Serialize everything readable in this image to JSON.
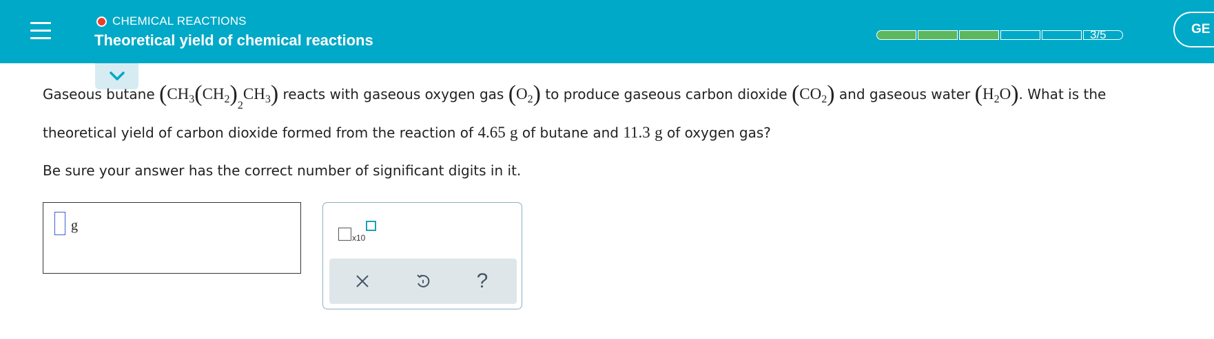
{
  "header": {
    "topic": "CHEMICAL REACTIONS",
    "title": "Theoretical yield of chemical reactions",
    "progress": {
      "completed": 3,
      "total": 5,
      "label": "3/5"
    },
    "go_button_label": "GE",
    "colors": {
      "header_bg": "#00a9c7",
      "progress_fill": "#5cb85c",
      "topic_dot": "#e8412c"
    }
  },
  "question": {
    "p1_a": "Gaseous butane",
    "p1_b": "reacts with gaseous oxygen gas",
    "p1_c": "to produce gaseous carbon dioxide",
    "p1_d": "and gaseous water",
    "p1_e": ". What is the",
    "butane": {
      "ch": "CH",
      "sub3": "3",
      "ch2": "CH",
      "sub2": "2",
      "outer_sub": "2",
      "ch3": "CH",
      "sub3b": "3"
    },
    "oxygen": {
      "o": "O",
      "sub": "2"
    },
    "co2": {
      "co": "CO",
      "sub": "2"
    },
    "water": {
      "h": "H",
      "sub": "2",
      "o": "O"
    },
    "p2_a": "theoretical yield of carbon dioxide formed from the reaction of",
    "mass_butane": "4.65",
    "unit_g": "g",
    "p2_b": "of butane and",
    "mass_oxygen": "11.3",
    "p2_c": "of oxygen gas?",
    "instruction": "Be sure your answer has the correct number of significant digits in it."
  },
  "answer": {
    "unit": "g",
    "value": ""
  },
  "toolbox": {
    "x10_label": "x10",
    "clear_icon": "x-icon",
    "undo_icon": "undo-icon",
    "help_icon": "help-icon",
    "help_label": "?"
  }
}
